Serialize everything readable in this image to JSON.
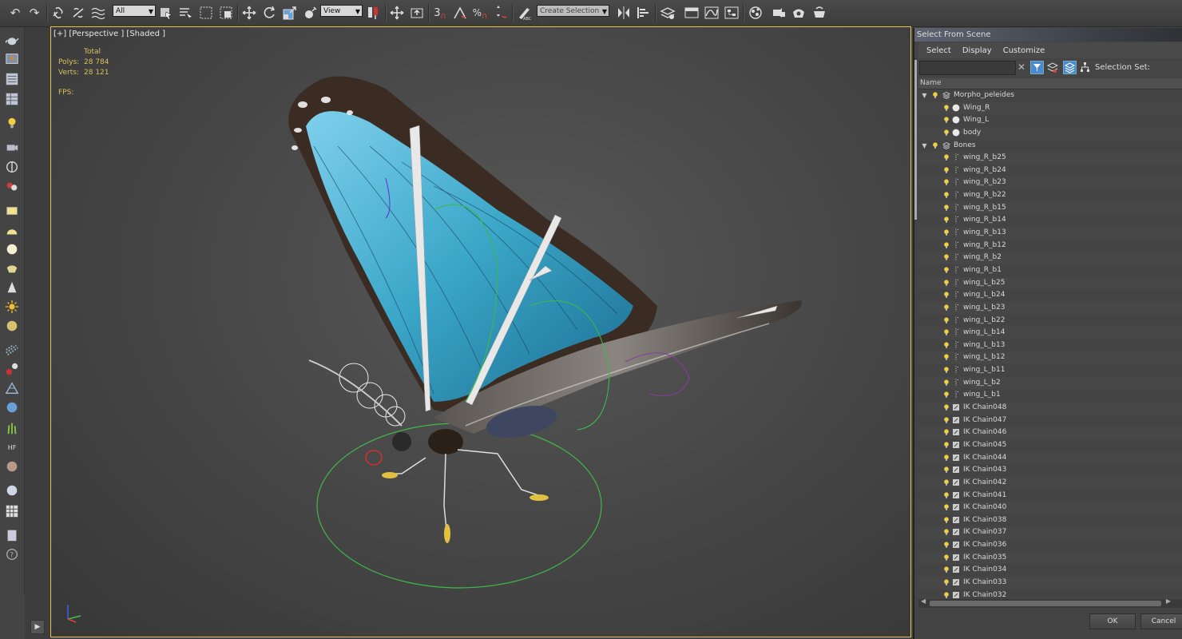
{
  "toolbar": {
    "selection_filter": "All",
    "reference_coord": "View",
    "named_selection_placeholder": "Create Selection Se",
    "snap_label": "3"
  },
  "viewport": {
    "label": "[+] [Perspective ] [Shaded ]",
    "stats": {
      "header": "Total",
      "polys_label": "Polys:",
      "polys_value": "28 784",
      "verts_label": "Verts:",
      "verts_value": "28 121",
      "fps_label": "FPS:"
    }
  },
  "scene_dialog": {
    "title": "Select From Scene",
    "menu": [
      "Select",
      "Display",
      "Customize"
    ],
    "selection_set_label": "Selection Set:",
    "column_header": "Name",
    "rows": [
      {
        "name": "Morpho_peleides",
        "level": 0,
        "type": "layer",
        "expanded": true
      },
      {
        "name": "Wing_R",
        "level": 1,
        "type": "mesh"
      },
      {
        "name": "Wing_L",
        "level": 1,
        "type": "mesh"
      },
      {
        "name": "body",
        "level": 1,
        "type": "mesh"
      },
      {
        "name": "Bones",
        "level": 0,
        "type": "layer",
        "expanded": true
      },
      {
        "name": "wing_R_b25",
        "level": 1,
        "type": "bone"
      },
      {
        "name": "wing_R_b24",
        "level": 1,
        "type": "bone"
      },
      {
        "name": "wing_R_b23",
        "level": 1,
        "type": "bone"
      },
      {
        "name": "wing_R_b22",
        "level": 1,
        "type": "bone"
      },
      {
        "name": "wing_R_b15",
        "level": 1,
        "type": "bone"
      },
      {
        "name": "wing_R_b14",
        "level": 1,
        "type": "bone"
      },
      {
        "name": "wing_R_b13",
        "level": 1,
        "type": "bone"
      },
      {
        "name": "wing_R_b12",
        "level": 1,
        "type": "bone"
      },
      {
        "name": "wing_R_b2",
        "level": 1,
        "type": "bone"
      },
      {
        "name": "wing_R_b1",
        "level": 1,
        "type": "bone"
      },
      {
        "name": "wing_L_b25",
        "level": 1,
        "type": "bone"
      },
      {
        "name": "wing_L_b24",
        "level": 1,
        "type": "bone"
      },
      {
        "name": "wing_L_b23",
        "level": 1,
        "type": "bone"
      },
      {
        "name": "wing_L_b22",
        "level": 1,
        "type": "bone"
      },
      {
        "name": "wing_L_b14",
        "level": 1,
        "type": "bone"
      },
      {
        "name": "wing_L_b13",
        "level": 1,
        "type": "bone"
      },
      {
        "name": "wing_L_b12",
        "level": 1,
        "type": "bone"
      },
      {
        "name": "wing_L_b11",
        "level": 1,
        "type": "bone"
      },
      {
        "name": "wing_L_b2",
        "level": 1,
        "type": "bone"
      },
      {
        "name": "wing_L_b1",
        "level": 1,
        "type": "bone"
      },
      {
        "name": "IK Chain048",
        "level": 1,
        "type": "ik"
      },
      {
        "name": "IK Chain047",
        "level": 1,
        "type": "ik"
      },
      {
        "name": "IK Chain046",
        "level": 1,
        "type": "ik"
      },
      {
        "name": "IK Chain045",
        "level": 1,
        "type": "ik"
      },
      {
        "name": "IK Chain044",
        "level": 1,
        "type": "ik"
      },
      {
        "name": "IK Chain043",
        "level": 1,
        "type": "ik"
      },
      {
        "name": "IK Chain042",
        "level": 1,
        "type": "ik"
      },
      {
        "name": "IK Chain041",
        "level": 1,
        "type": "ik"
      },
      {
        "name": "IK Chain040",
        "level": 1,
        "type": "ik"
      },
      {
        "name": "IK Chain038",
        "level": 1,
        "type": "ik"
      },
      {
        "name": "IK Chain037",
        "level": 1,
        "type": "ik"
      },
      {
        "name": "IK Chain036",
        "level": 1,
        "type": "ik"
      },
      {
        "name": "IK Chain035",
        "level": 1,
        "type": "ik"
      },
      {
        "name": "IK Chain034",
        "level": 1,
        "type": "ik"
      },
      {
        "name": "IK Chain033",
        "level": 1,
        "type": "ik"
      },
      {
        "name": "IK Chain032",
        "level": 1,
        "type": "ik"
      }
    ],
    "ok_label": "OK",
    "cancel_label": "Cancel"
  },
  "colors": {
    "wing_blue": "#3aa6c8",
    "viewport_border": "#e8c050",
    "stats_text": "#d9c15a",
    "bulb": "#f0d040"
  }
}
